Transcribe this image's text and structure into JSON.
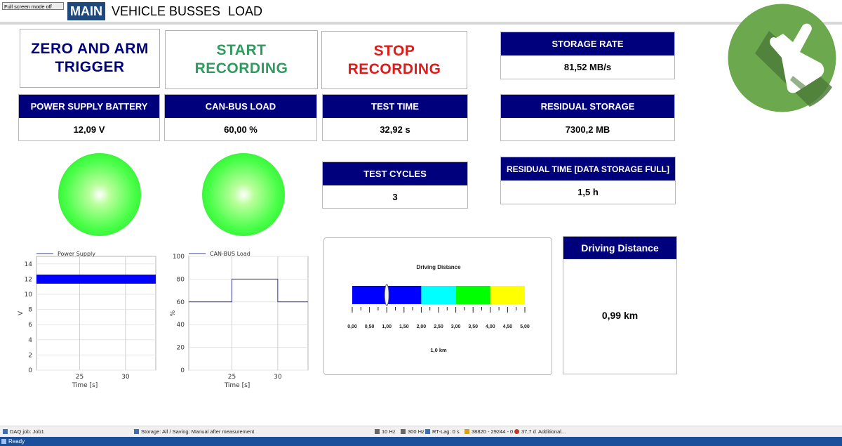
{
  "header": {
    "fullscreen_button": "Full screen mode off",
    "tabs": [
      "MAIN",
      "VEHICLE BUSSES",
      "LOAD"
    ]
  },
  "buttons": {
    "zero_arm": "ZERO AND ARM\nTRIGGER",
    "start": "START\nRECORDING",
    "stop": "STOP\nRECORDING"
  },
  "colors": {
    "header_blue": "#00007d",
    "start_green": "#2e9c5e",
    "stop_red": "#e11a1a",
    "led_green": "#33ff33"
  },
  "panels": {
    "storage_rate": {
      "title": "STORAGE RATE",
      "value": "81,52 MB/s"
    },
    "power_supply": {
      "title": "POWER SUPPLY BATTERY",
      "value": "12,09 V"
    },
    "can_load": {
      "title": "CAN-BUS LOAD",
      "value": "60,00 %"
    },
    "test_time": {
      "title": "TEST TIME",
      "value": "32,92 s"
    },
    "residual_storage": {
      "title": "RESIDUAL STORAGE",
      "value": "7300,2 MB"
    },
    "test_cycles": {
      "title": "TEST CYCLES",
      "value": "3"
    },
    "residual_time": {
      "title": "RESIDUAL TIME [DATA STORAGE FULL]",
      "value": "1,5 h"
    },
    "driving_distance": {
      "title": "Driving Distance",
      "value": "0,99 km"
    }
  },
  "chart_data": [
    {
      "type": "line",
      "legend": "Power Supply",
      "xlabel": "Time  [s]",
      "ylabel": "V",
      "xlim": [
        20.3,
        33.3
      ],
      "ylim": [
        0,
        15
      ],
      "yticks": [
        0,
        2,
        4,
        6,
        8,
        10,
        12,
        14
      ],
      "xticks": [
        25,
        30
      ],
      "series": [
        {
          "name": "Power Supply",
          "band": [
            11.4,
            12.6
          ],
          "x": [
            20.3,
            33.3
          ],
          "y": [
            12.09,
            12.09
          ]
        }
      ]
    },
    {
      "type": "line",
      "legend": "CAN-BUS Load",
      "xlabel": "Time  [s]",
      "ylabel": "%",
      "xlim": [
        20.3,
        33.3
      ],
      "ylim": [
        0,
        100
      ],
      "yticks": [
        0,
        20,
        40,
        60,
        80,
        100
      ],
      "xticks": [
        25,
        30
      ],
      "series": [
        {
          "name": "CAN-BUS Load",
          "x": [
            20.3,
            25,
            25,
            30,
            30,
            33.3
          ],
          "y": [
            60,
            60,
            80,
            80,
            60,
            60
          ]
        }
      ]
    }
  ],
  "gauge": {
    "title": "Driving Distance",
    "min": 0,
    "max": 5,
    "value": 1.0,
    "value_label": "1,0 km",
    "tick_labels": [
      "0,00",
      "0,50",
      "1,00",
      "1,50",
      "2,00",
      "2,50",
      "3,00",
      "3,50",
      "4,00",
      "4,50",
      "5,00"
    ],
    "bands": [
      {
        "from": 0,
        "to": 2,
        "color": "#0000ff"
      },
      {
        "from": 2,
        "to": 3,
        "color": "#00ffff"
      },
      {
        "from": 3,
        "to": 4,
        "color": "#00ff00"
      },
      {
        "from": 4,
        "to": 5,
        "color": "#ffff00"
      }
    ]
  },
  "status": {
    "daq_job": "DAQ job: Job1",
    "storage": "Storage: All / Saving: Manual after measurement",
    "rates": "10 Hz",
    "rate2": "300 Hz",
    "rt_lag": "RT-Lag: 0 s",
    "mem": "38820 - 29244 - 0",
    "days": "37,7 d",
    "additional": "Additional...",
    "ready": "Ready"
  },
  "icons": {
    "logo": "hand-pointer-icon"
  }
}
